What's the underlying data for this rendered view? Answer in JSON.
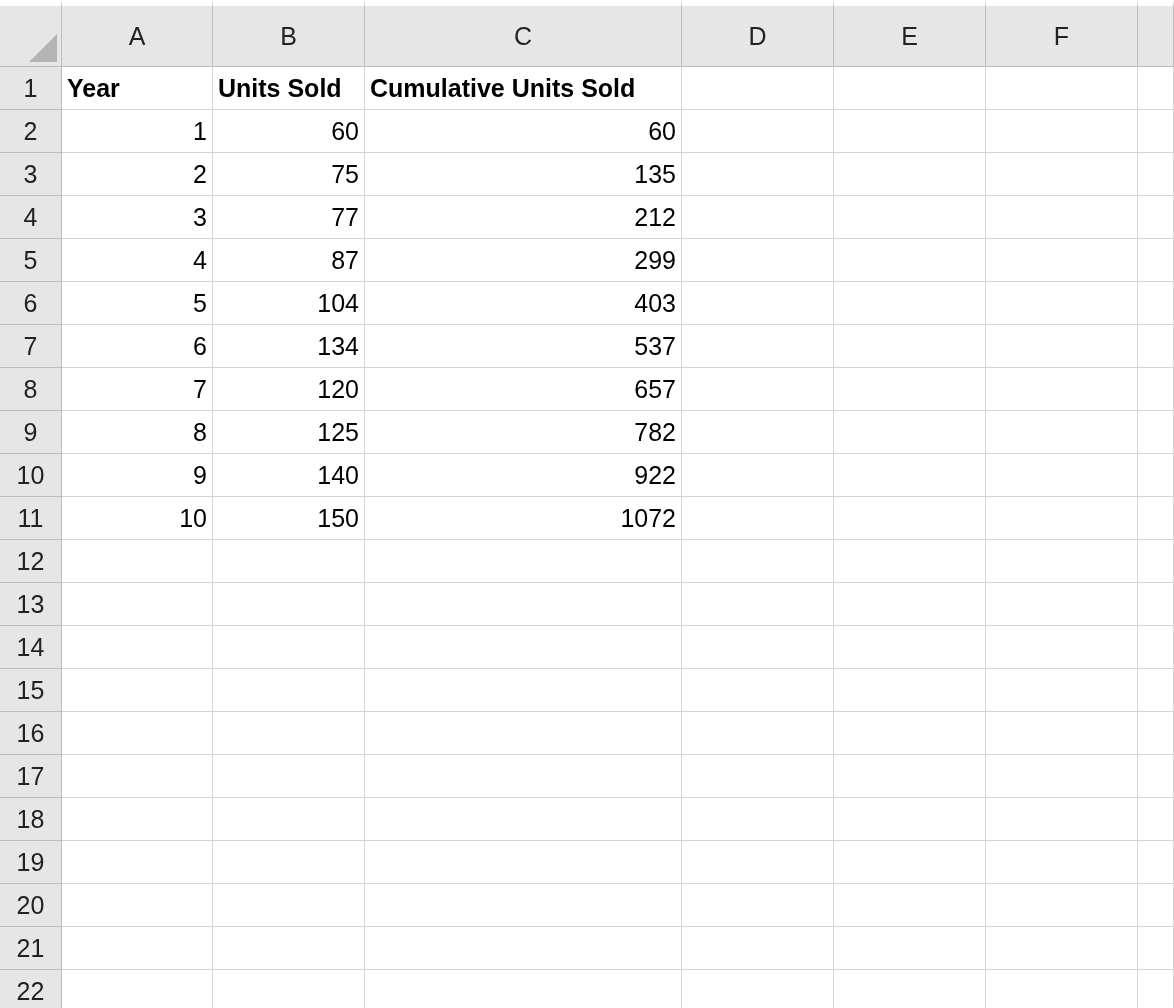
{
  "columns": [
    "A",
    "B",
    "C",
    "D",
    "E",
    "F"
  ],
  "rows": [
    {
      "number": "1",
      "kind": "header",
      "cells": [
        "Year",
        "Units Sold",
        "Cumulative Units Sold"
      ]
    },
    {
      "number": "2",
      "kind": "data",
      "cells": [
        "1",
        "60",
        "60"
      ]
    },
    {
      "number": "3",
      "kind": "data",
      "cells": [
        "2",
        "75",
        "135"
      ]
    },
    {
      "number": "4",
      "kind": "data",
      "cells": [
        "3",
        "77",
        "212"
      ]
    },
    {
      "number": "5",
      "kind": "data",
      "cells": [
        "4",
        "87",
        "299"
      ]
    },
    {
      "number": "6",
      "kind": "data",
      "cells": [
        "5",
        "104",
        "403"
      ]
    },
    {
      "number": "7",
      "kind": "data",
      "cells": [
        "6",
        "134",
        "537"
      ]
    },
    {
      "number": "8",
      "kind": "data",
      "cells": [
        "7",
        "120",
        "657"
      ]
    },
    {
      "number": "9",
      "kind": "data",
      "cells": [
        "8",
        "125",
        "782"
      ]
    },
    {
      "number": "10",
      "kind": "data",
      "cells": [
        "9",
        "140",
        "922"
      ]
    },
    {
      "number": "11",
      "kind": "data",
      "cells": [
        "10",
        "150",
        "1072"
      ]
    },
    {
      "number": "12",
      "cells": []
    },
    {
      "number": "13",
      "cells": []
    },
    {
      "number": "14",
      "cells": []
    },
    {
      "number": "15",
      "cells": []
    },
    {
      "number": "16",
      "cells": []
    },
    {
      "number": "17",
      "cells": []
    },
    {
      "number": "18",
      "cells": []
    },
    {
      "number": "19",
      "cells": []
    },
    {
      "number": "20",
      "cells": []
    },
    {
      "number": "21",
      "cells": []
    },
    {
      "number": "22",
      "cells": []
    }
  ]
}
